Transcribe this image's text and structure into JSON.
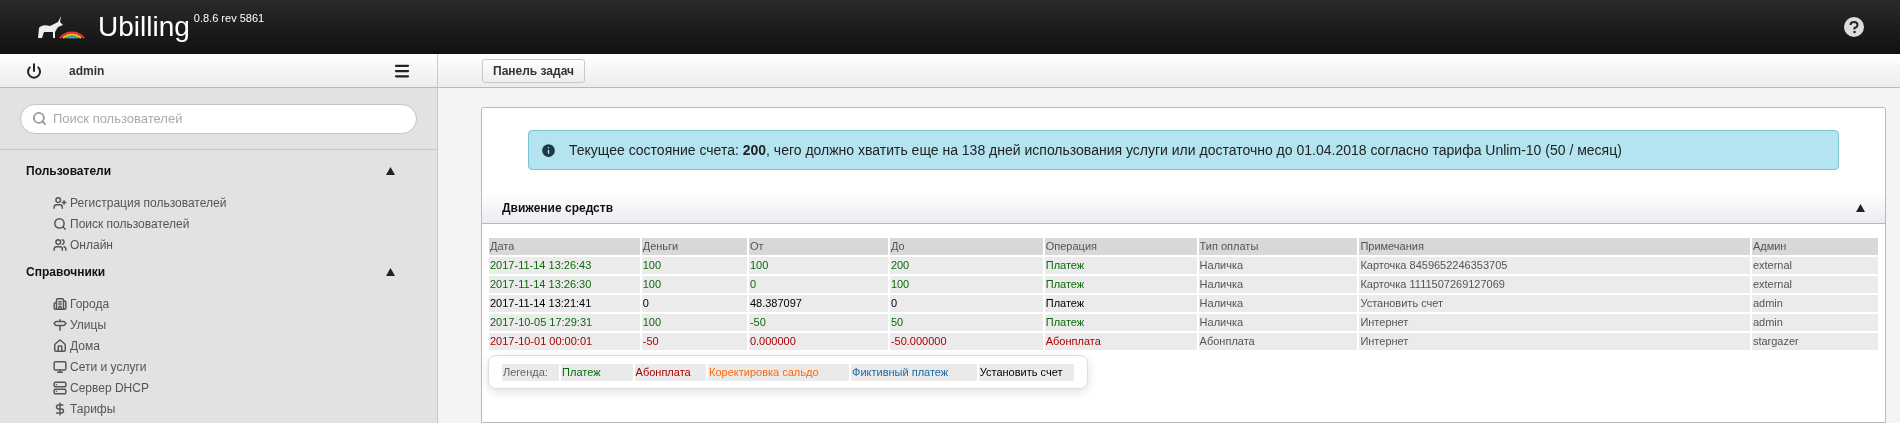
{
  "header": {
    "title": "Ubilling",
    "version": "0.8.6 rev 5861"
  },
  "sidebar": {
    "user": "admin",
    "search": {
      "placeholder": "Поиск пользователей"
    },
    "sections": [
      {
        "title": "Пользователи",
        "expanded": true,
        "items": [
          {
            "label": "Регистрация пользователей"
          },
          {
            "label": "Поиск пользователей"
          },
          {
            "label": "Онлайн"
          }
        ]
      },
      {
        "title": "Справочники",
        "expanded": true,
        "items": [
          {
            "label": "Города"
          },
          {
            "label": "Улицы"
          },
          {
            "label": "Дома"
          },
          {
            "label": "Сети и услуги"
          },
          {
            "label": "Сервер DHCP"
          },
          {
            "label": "Тарифы"
          }
        ]
      }
    ]
  },
  "toolbar": {
    "button": "Панель задач"
  },
  "info": {
    "text": "Текущее состояние счета: **200**, чего должно хватить еще на 138 дней использования услуги или достаточно до 01.04.2018 согласно тарифа Unlim-10 (50 / месяц)"
  },
  "section": {
    "title": "Движение средств",
    "expanded": true
  },
  "table": {
    "columns": [
      "Дата",
      "Деньги",
      "От",
      "До",
      "Операция",
      "Тип оплаты",
      "Примечания",
      "Админ"
    ],
    "rows": [
      {
        "kind": "payment",
        "cells": [
          "2017-11-14 13:26:43",
          "100",
          "100",
          "200",
          "Платеж",
          "Наличка",
          "Карточка 8459652246353705",
          "external"
        ]
      },
      {
        "kind": "payment",
        "cells": [
          "2017-11-14 13:26:30",
          "100",
          "0",
          "100",
          "Платеж",
          "Наличка",
          "Карточка 1111507269127069",
          "external"
        ]
      },
      {
        "kind": "set",
        "cells": [
          "2017-11-14 13:21:41",
          "0",
          "48.387097",
          "0",
          "Платеж",
          "Наличка",
          "Установить счет",
          "admin"
        ]
      },
      {
        "kind": "payment",
        "cells": [
          "2017-10-05 17:29:31",
          "100",
          "-50",
          "50",
          "Платеж",
          "Наличка",
          "Интернет",
          "admin"
        ]
      },
      {
        "kind": "fee",
        "cells": [
          "2017-10-01 00:00:01",
          "-50",
          "0.000000",
          "-50.000000",
          "Абонплата",
          "Абонплата",
          "Интернет",
          "stargazer"
        ]
      }
    ]
  },
  "legend": {
    "label": "Легенда:",
    "items": [
      {
        "kind": "payment",
        "label": "Платеж"
      },
      {
        "kind": "fee",
        "label": "Абонплата"
      },
      {
        "kind": "correction",
        "label": "Коректировка сальдо"
      },
      {
        "kind": "fictive",
        "label": "Фиктивный платеж"
      },
      {
        "kind": "set",
        "label": "Установить счет"
      }
    ]
  }
}
